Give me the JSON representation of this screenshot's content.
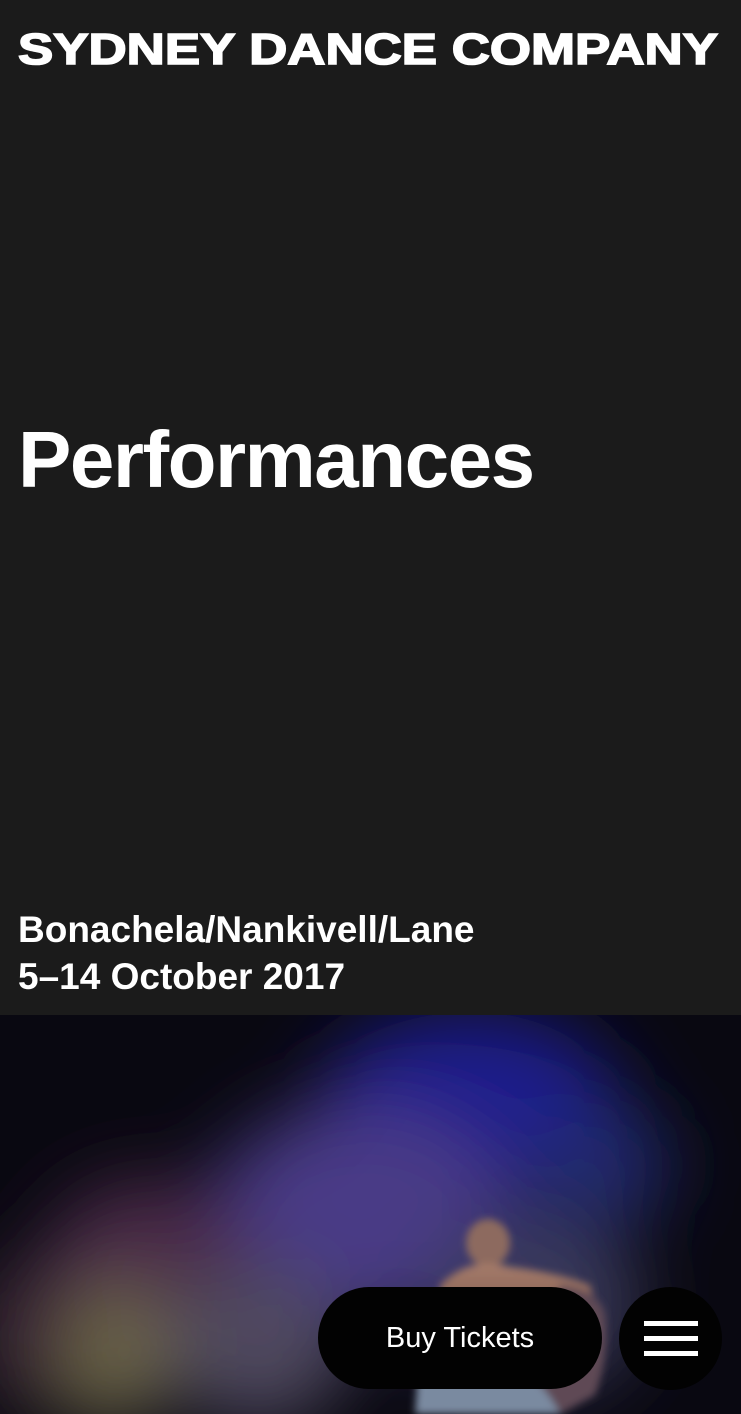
{
  "header": {
    "logo_text": "SYDNEY DANCE COMPANY"
  },
  "main": {
    "title": "Performances",
    "show": {
      "name": "Bonachela/Nankivell/Lane",
      "dates": "5–14 October 2017"
    }
  },
  "actions": {
    "buy_tickets_label": "Buy Tickets",
    "menu_icon": "hamburger-menu-icon"
  },
  "colors": {
    "background": "#1b1b1b",
    "text": "#ffffff",
    "button_background": "#020202"
  }
}
